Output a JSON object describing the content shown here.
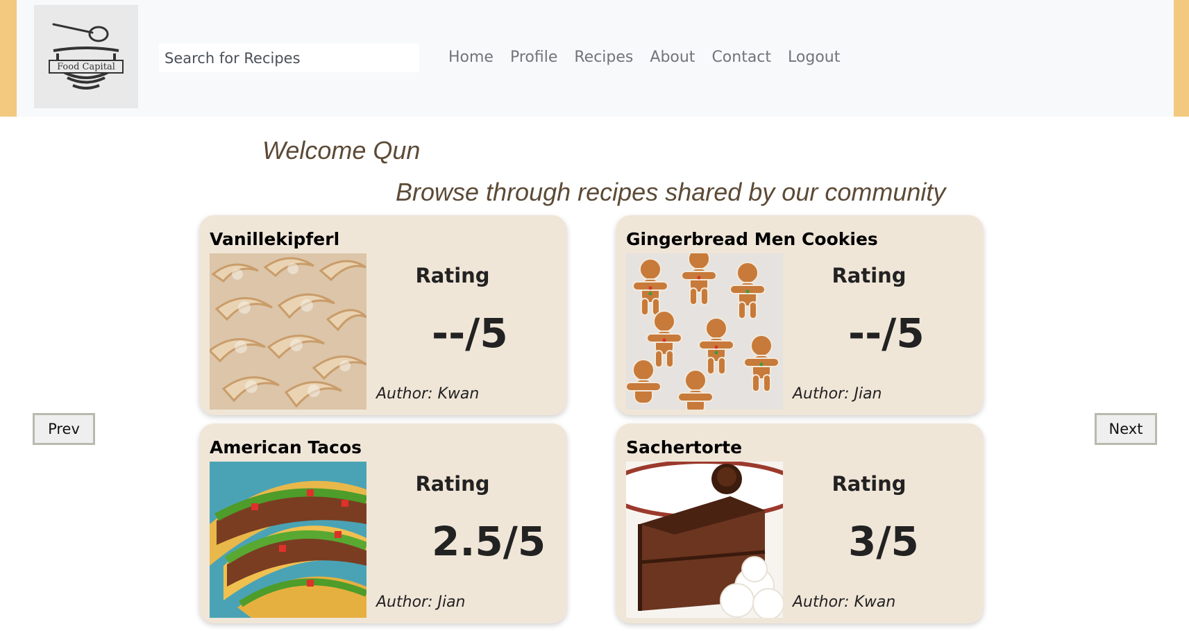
{
  "header": {
    "logo_text": "Food Capital",
    "search_placeholder": "Search for Recipes",
    "nav": [
      "Home",
      "Profile",
      "Recipes",
      "About",
      "Contact",
      "Logout"
    ]
  },
  "main": {
    "welcome": "Welcome Qun",
    "subtitle": "Browse through recipes shared by our community",
    "prev_label": "Prev",
    "next_label": "Next",
    "rating_label": "Rating",
    "recipes": [
      {
        "title": "Vanillekipferl",
        "rating": "--/5",
        "author": "Author: Kwan",
        "image": "vanillekipferl-cookies-photo"
      },
      {
        "title": "Gingerbread Men Cookies",
        "rating": "--/5",
        "author": "Author: Jian",
        "image": "gingerbread-men-photo"
      },
      {
        "title": "American Tacos",
        "rating": "2.5/5",
        "author": "Author: Jian",
        "image": "tacos-photo"
      },
      {
        "title": "Sachertorte",
        "rating": "3/5",
        "author": "Author: Kwan",
        "image": "sachertorte-cake-photo"
      }
    ]
  },
  "colors": {
    "accent": "#f2c97e",
    "card_bg": "#f0e6d8",
    "heading_text": "#5c4a36"
  }
}
